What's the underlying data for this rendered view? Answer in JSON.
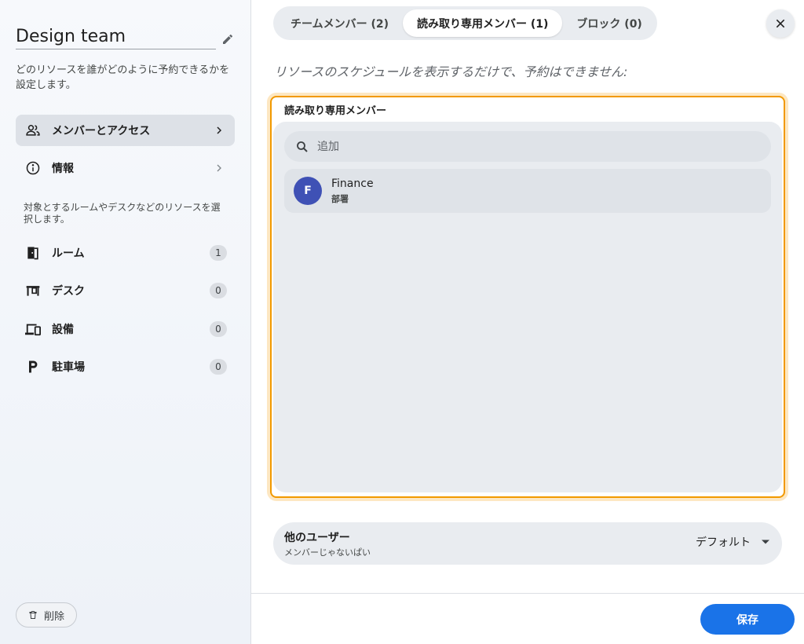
{
  "sidebar": {
    "team_title": "Design team",
    "team_description": "どのリソースを誰がどのように予約できるかを設定します。",
    "nav": [
      {
        "label": "メンバーとアクセス",
        "icon": "people-icon",
        "active": true
      },
      {
        "label": "情報",
        "icon": "info-icon",
        "active": false
      }
    ],
    "resource_description": "対象とするルームやデスクなどのリソースを選択します。",
    "resources": [
      {
        "label": "ルーム",
        "icon": "door-icon",
        "count": "1"
      },
      {
        "label": "デスク",
        "icon": "desk-icon",
        "count": "0"
      },
      {
        "label": "設備",
        "icon": "devices-icon",
        "count": "0"
      },
      {
        "label": "駐車場",
        "icon": "parking-icon",
        "count": "0"
      }
    ],
    "delete_label": "削除"
  },
  "tabs": [
    {
      "label": "チームメンバー (2)",
      "active": false
    },
    {
      "label": "読み取り専用メンバー (1)",
      "active": true
    },
    {
      "label": "ブロック (0)",
      "active": false
    }
  ],
  "subtitle": "リソースのスケジュールを表示するだけで、予約はできません:",
  "panel": {
    "title": "読み取り専用メンバー",
    "search_placeholder": "追加",
    "members": [
      {
        "initial": "F",
        "name": "Finance",
        "type": "部署"
      }
    ]
  },
  "other_users": {
    "title": "他のユーザー",
    "subtitle": "メンバーじゃないぱい",
    "selected": "デフォルト"
  },
  "save_label": "保存",
  "colors": {
    "accent": "#1a73e8",
    "highlight_border": "#f29900",
    "avatar": "#3f51b5"
  }
}
